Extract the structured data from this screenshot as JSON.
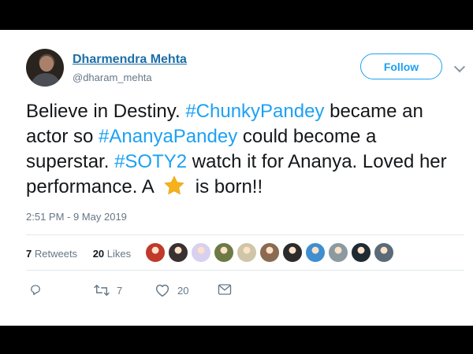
{
  "user": {
    "name": "Dharmendra Mehta",
    "handle": "@dharam_mehta",
    "follow_label": "Follow"
  },
  "tweet": {
    "t1": "Believe in Destiny. ",
    "tag1": "#ChunkyPandey",
    "t2": " became an actor so ",
    "tag2": "#AnanyaPandey",
    "t3": " could become a superstar. ",
    "tag3": "#SOTY2",
    "t4": " watch it for Ananya. Loved her performance. A ",
    "t5": " is born!!",
    "emoji": "star-emoji"
  },
  "timestamp": "2:51 PM - 9 May 2019",
  "stats": {
    "retweets_count": "7",
    "retweets_label": "Retweets",
    "likes_count": "20",
    "likes_label": "Likes"
  },
  "likers": [
    {
      "color": "#c0392b"
    },
    {
      "color": "#3a3030"
    },
    {
      "color": "#d7d0f0"
    },
    {
      "color": "#6d7a45"
    },
    {
      "color": "#cfc6a8"
    },
    {
      "color": "#8a6a50"
    },
    {
      "color": "#2b2b2b"
    },
    {
      "color": "#3f8fd0"
    },
    {
      "color": "#8a9aa0"
    },
    {
      "color": "#1f2a33"
    },
    {
      "color": "#5a6a78"
    }
  ],
  "actions": {
    "reply_count": "",
    "retweet_count": "7",
    "like_count": "20"
  },
  "colors": {
    "link": "#1da1f2",
    "name": "#1b6fa8",
    "secondary": "#657786"
  }
}
